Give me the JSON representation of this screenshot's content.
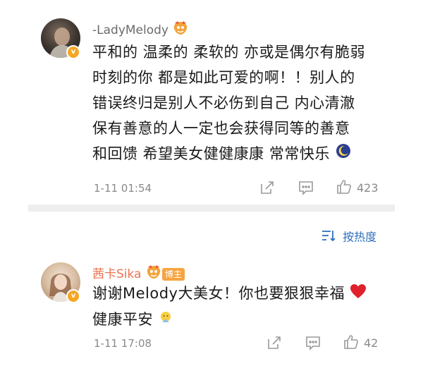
{
  "comments": [
    {
      "username": "-LadyMelody",
      "text_lines": [
        "平和的 温柔的 柔软的 亦或是偶尔有脆弱",
        "时刻的你  都是如此可爱的啊！！别人的",
        "错误终归是别人不必伤到自己  内心清澈",
        "保有善意的人一定也会获得同等的善意",
        "和回馈   希望美女健健康康 常常快乐"
      ],
      "time": "1-11 01:54",
      "likes": "423",
      "emoji": "sleeping-moon-emoji"
    },
    {
      "username": "茜卡Sika",
      "author_tag": "博主",
      "text_lines": [
        "谢谢Melody大美女！你也要狠狠幸福",
        "健康平安"
      ],
      "time": "1-11 17:08",
      "likes": "42"
    }
  ],
  "sort": {
    "label": "按热度"
  },
  "colors": {
    "username_muted": "#6b6b6b",
    "username_orange": "#eb7350",
    "verified_badge": "#f5a623",
    "sort_blue": "#2f6fbd",
    "divider": "#eeeeee"
  }
}
